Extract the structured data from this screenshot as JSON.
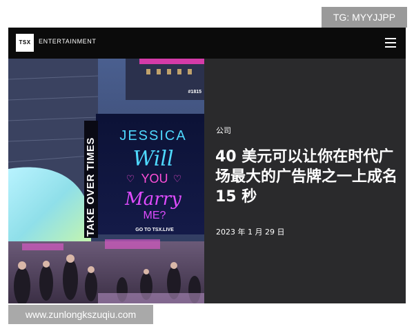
{
  "watermark": {
    "tg": "TG: MYYJJPP",
    "url": "www.zunlongkszuqiu.com"
  },
  "header": {
    "logo_text": "TSX",
    "brand_name": "ENTERTAINMENT",
    "menu_icon": "hamburger-menu-icon"
  },
  "hero_image": {
    "billboard_code": "#1815",
    "side_banner": "TAKE OVER TIMES",
    "line1": "JESSICA",
    "line2": "Will",
    "line3": "YOU",
    "line4": "Marry",
    "line5": "ME?",
    "cta": "GO TO TSX.LIVE"
  },
  "article": {
    "category": "公司",
    "title": "40 美元可以让你在时代广场最大的广告牌之一上成名 15 秒",
    "date": "2023 年 1 月 29 日"
  },
  "colors": {
    "frame_bg": "#2a2a2c",
    "topbar_bg": "#0b0b0b",
    "neon_cyan": "#4fd9ff",
    "neon_pink": "#ff4fd8",
    "neon_magenta": "#e04cff"
  }
}
